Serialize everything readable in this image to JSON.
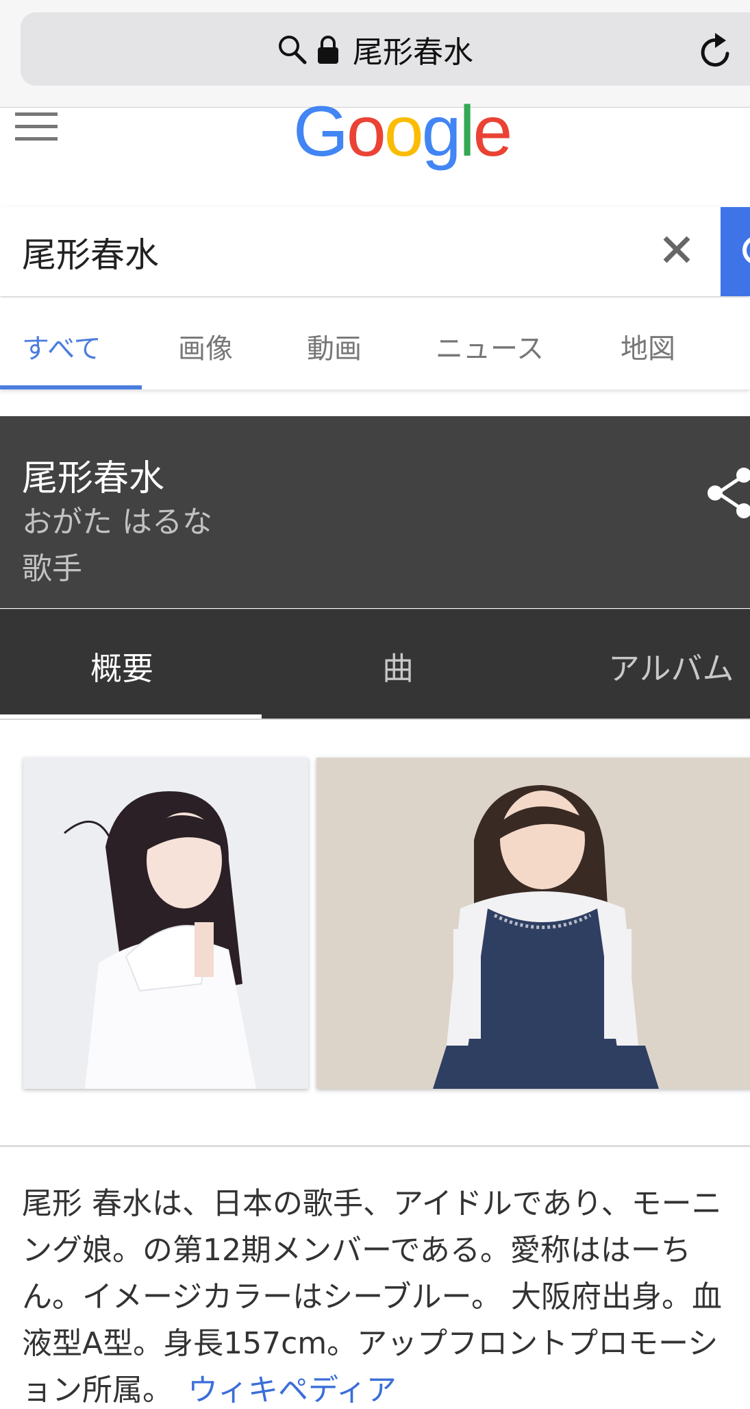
{
  "browser": {
    "address_text": "尾形春水"
  },
  "google": {
    "logo_letters": [
      "G",
      "o",
      "o",
      "g",
      "l",
      "e"
    ],
    "logo_colors": [
      "#4285f4",
      "#ea4335",
      "#fbbc05",
      "#4285f4",
      "#34a853",
      "#ea4335"
    ]
  },
  "search": {
    "query": "尾形春水"
  },
  "tabs": [
    {
      "label": "すべて"
    },
    {
      "label": "画像"
    },
    {
      "label": "動画"
    },
    {
      "label": "ニュース"
    },
    {
      "label": "地図"
    }
  ],
  "knowledge_panel": {
    "title": "尾形春水",
    "reading": "おがた はるな",
    "type": "歌手",
    "tabs": [
      {
        "label": "概要"
      },
      {
        "label": "曲"
      },
      {
        "label": "アルバム"
      }
    ]
  },
  "description": {
    "lines": [
      "尾形 春水は、日本の歌手、アイドルであり、モーニ",
      "ング娘。の第12期メンバーである。愛称ははーち",
      "ん。イメージカラーはシーブルー。 大阪府出身。血",
      "液型A型。身長157cm。アップフロントプロモーシ",
      "ョン所属。"
    ],
    "link_label": "ウィキペディア"
  },
  "colors": {
    "accent_blue": "#4b7ddf",
    "panel_dark": "#424242"
  }
}
